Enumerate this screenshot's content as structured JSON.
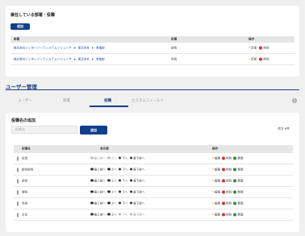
{
  "dept_section": {
    "title": "兼任している部署・役職",
    "add_label": "追加",
    "headers": {
      "dept": "部署",
      "position": "役職",
      "ops": "操作"
    },
    "rows": [
      {
        "path": [
          "株式会社インターゾーラシステムソリューサ",
          "東京本社",
          "営業部"
        ],
        "position": "部長",
        "edit": "変更",
        "delete": "削除"
      },
      {
        "path": [
          "株式会社インターゾーラシステムソリューサ",
          "東京本社",
          "営業部"
        ],
        "position": "係長",
        "edit": "変更",
        "delete": "削除"
      }
    ]
  },
  "page_title": "ユーザー管理",
  "tabs": [
    {
      "label": "ユーザー",
      "active": false
    },
    {
      "label": "部署",
      "active": false
    },
    {
      "label": "役職",
      "active": true
    },
    {
      "label": "カスタムフィールド",
      "active": false
    }
  ],
  "help_label": "?",
  "position_section": {
    "title": "役職名の追加",
    "input_placeholder": "役職名",
    "add_label": "追加",
    "total": "合計 6件",
    "headers": {
      "name": "役職名",
      "order": "表示順",
      "ops": "操作"
    },
    "order_labels": {
      "top": "最上部へ",
      "up": "上へ",
      "down": "下へ",
      "bottom": "最下部へ"
    },
    "op_labels": {
      "edit": "編集",
      "delete": "削除",
      "history": "履歴"
    },
    "rows": [
      {
        "name": "役員"
      },
      {
        "name": "統括部長"
      },
      {
        "name": "部長"
      },
      {
        "name": "課長"
      },
      {
        "name": "係長"
      },
      {
        "name": "主任"
      }
    ]
  }
}
